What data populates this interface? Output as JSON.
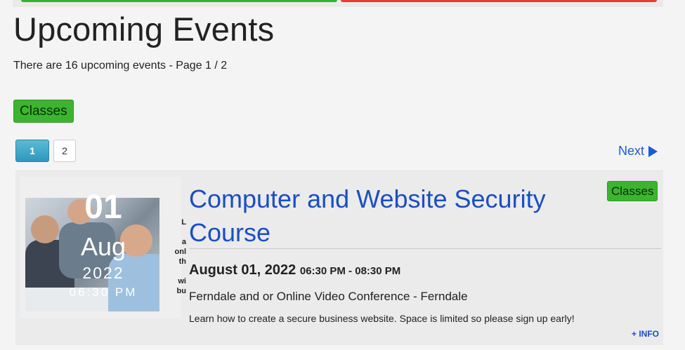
{
  "page": {
    "title": "Upcoming Events",
    "subtitle": "There are 16 upcoming events - Page 1 / 2"
  },
  "filter": {
    "category_label": "Classes"
  },
  "pagination": {
    "pages": [
      "1",
      "2"
    ],
    "active_page": "1",
    "next_label": "Next"
  },
  "event": {
    "date_day": "01",
    "date_month": "Aug",
    "date_year": "2022",
    "date_time": "06:30 PM",
    "thumb_side_text": "L\na\nonl\nth\nwi\nbu",
    "category": "Classes",
    "title": "Computer and Website Security Course",
    "date": "August 01, 2022",
    "time": "06:30 PM - 08:30 PM",
    "location": "Ferndale and or Online Video Conference - Ferndale",
    "description": "Learn how to create a secure business website. Space is limited so please sign up early!",
    "more_info_label": "+ INFO"
  },
  "colors": {
    "category_green": "#3bb52f",
    "link_blue": "#1a4ec4",
    "pager_active": "#2f97bd",
    "top_bar_green": "#2fb52f",
    "top_bar_red": "#e53b3b"
  }
}
